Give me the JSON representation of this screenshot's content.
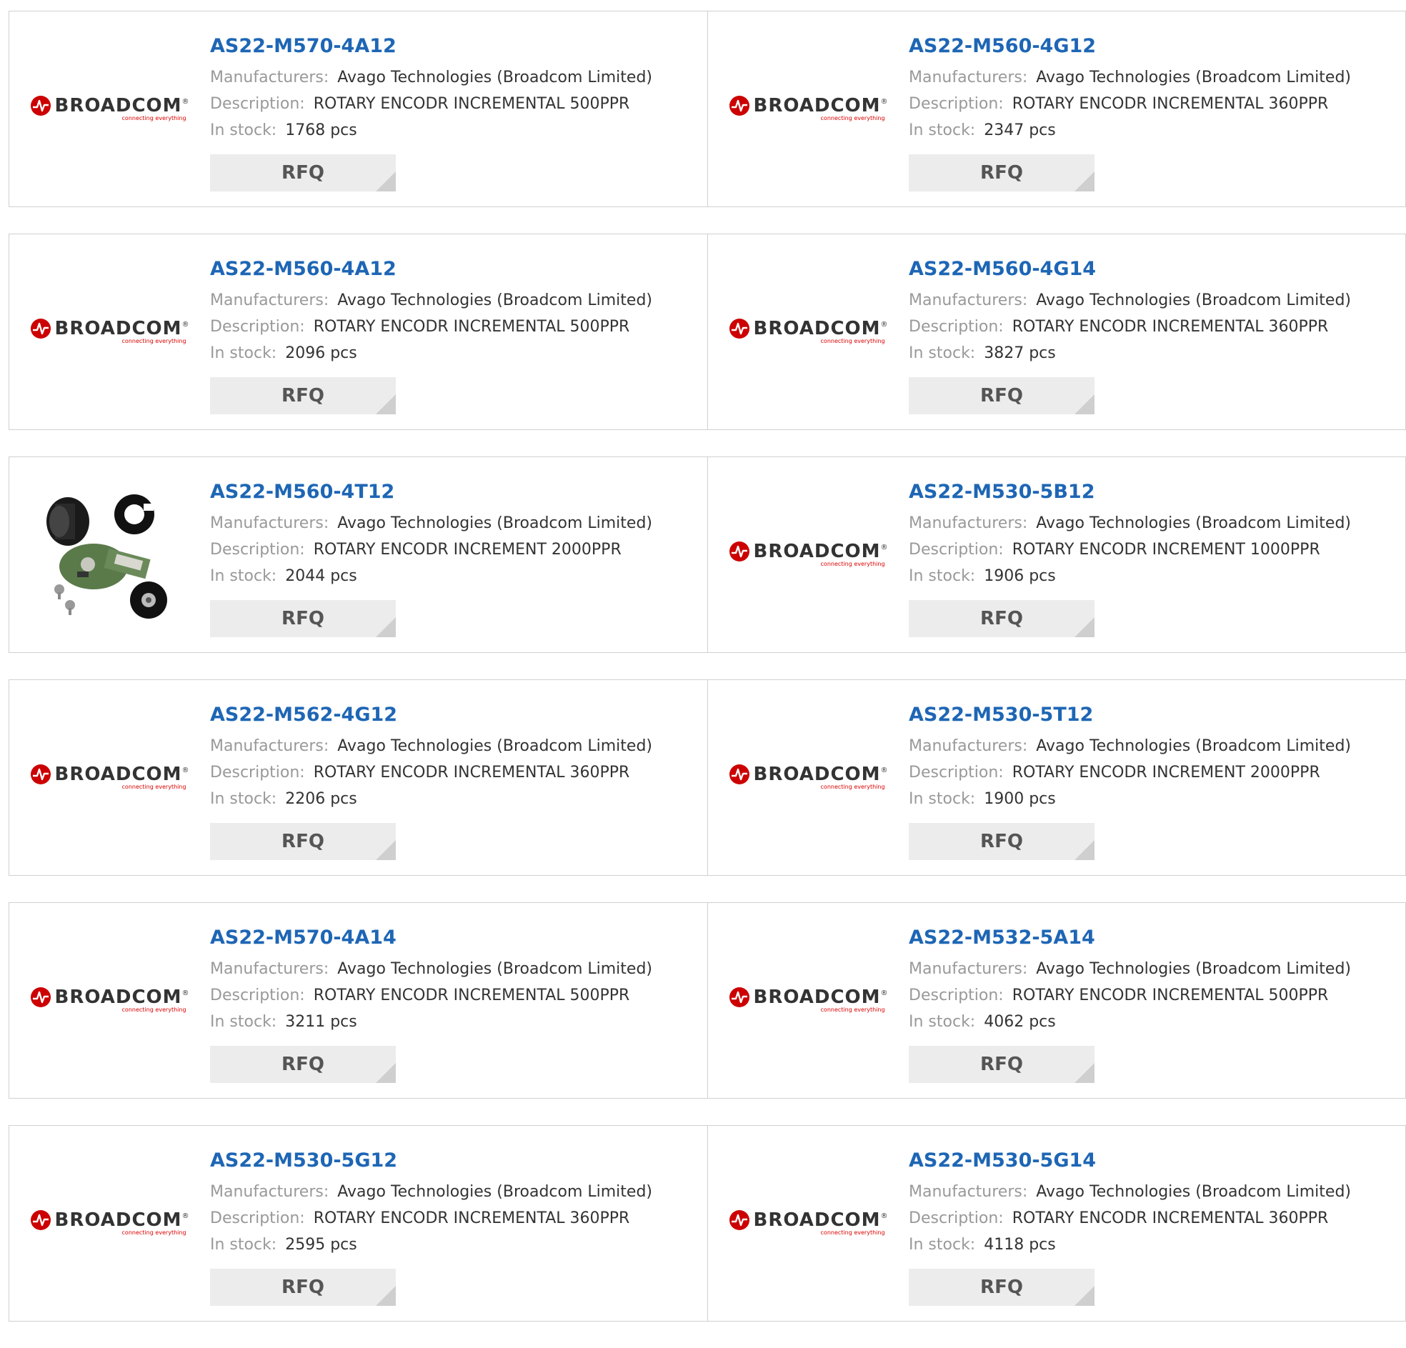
{
  "labels": {
    "manufacturers": "Manufacturers:",
    "description": "Description:",
    "in_stock": "In stock:",
    "rfq": "RFQ",
    "logo_text": "BROADCOM",
    "logo_reg": "®",
    "logo_tagline": "connecting everything"
  },
  "colors": {
    "part_link": "#1e66b5",
    "label_gray": "#999999",
    "value_dark": "#333333",
    "brand_red": "#cc0000"
  },
  "products": [
    {
      "part": "AS22-M570-4A12",
      "manufacturer": "Avago Technologies (Broadcom Limited)",
      "description": "ROTARY ENCODR INCREMENTAL 500PPR",
      "stock": "1768 pcs",
      "image": "broadcom-logo"
    },
    {
      "part": "AS22-M560-4G12",
      "manufacturer": "Avago Technologies (Broadcom Limited)",
      "description": "ROTARY ENCODR INCREMENTAL 360PPR",
      "stock": "2347 pcs",
      "image": "broadcom-logo"
    },
    {
      "part": "AS22-M560-4A12",
      "manufacturer": "Avago Technologies (Broadcom Limited)",
      "description": "ROTARY ENCODR INCREMENTAL 500PPR",
      "stock": "2096 pcs",
      "image": "broadcom-logo"
    },
    {
      "part": "AS22-M560-4G14",
      "manufacturer": "Avago Technologies (Broadcom Limited)",
      "description": "ROTARY ENCODR INCREMENTAL 360PPR",
      "stock": "3827 pcs",
      "image": "broadcom-logo"
    },
    {
      "part": "AS22-M560-4T12",
      "manufacturer": "Avago Technologies (Broadcom Limited)",
      "description": "ROTARY ENCODR INCREMENT 2000PPR",
      "stock": "2044 pcs",
      "image": "encoder-kit-photo"
    },
    {
      "part": "AS22-M530-5B12",
      "manufacturer": "Avago Technologies (Broadcom Limited)",
      "description": "ROTARY ENCODR INCREMENT 1000PPR",
      "stock": "1906 pcs",
      "image": "broadcom-logo"
    },
    {
      "part": "AS22-M562-4G12",
      "manufacturer": "Avago Technologies (Broadcom Limited)",
      "description": "ROTARY ENCODR INCREMENTAL 360PPR",
      "stock": "2206 pcs",
      "image": "broadcom-logo"
    },
    {
      "part": "AS22-M530-5T12",
      "manufacturer": "Avago Technologies (Broadcom Limited)",
      "description": "ROTARY ENCODR INCREMENT 2000PPR",
      "stock": "1900 pcs",
      "image": "broadcom-logo"
    },
    {
      "part": "AS22-M570-4A14",
      "manufacturer": "Avago Technologies (Broadcom Limited)",
      "description": "ROTARY ENCODR INCREMENTAL 500PPR",
      "stock": "3211 pcs",
      "image": "broadcom-logo"
    },
    {
      "part": "AS22-M532-5A14",
      "manufacturer": "Avago Technologies (Broadcom Limited)",
      "description": "ROTARY ENCODR INCREMENTAL 500PPR",
      "stock": "4062 pcs",
      "image": "broadcom-logo"
    },
    {
      "part": "AS22-M530-5G12",
      "manufacturer": "Avago Technologies (Broadcom Limited)",
      "description": "ROTARY ENCODR INCREMENTAL 360PPR",
      "stock": "2595 pcs",
      "image": "broadcom-logo"
    },
    {
      "part": "AS22-M530-5G14",
      "manufacturer": "Avago Technologies (Broadcom Limited)",
      "description": "ROTARY ENCODR INCREMENTAL 360PPR",
      "stock": "4118 pcs",
      "image": "broadcom-logo"
    }
  ]
}
